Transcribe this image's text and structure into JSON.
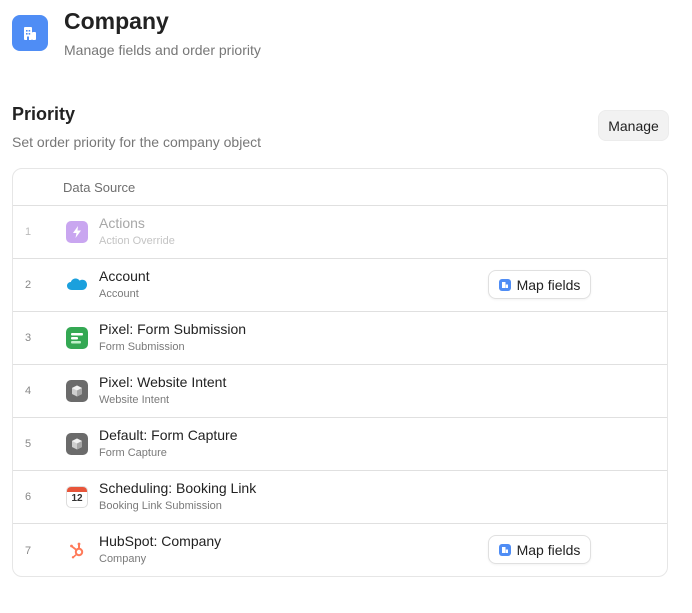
{
  "header": {
    "title": "Company",
    "subtitle": "Manage fields and order priority",
    "icon": "building-icon",
    "icon_color": "#4f8df5"
  },
  "priority": {
    "title": "Priority",
    "subtitle": "Set order priority for the company object",
    "manage_label": "Manage"
  },
  "table": {
    "column_header": "Data Source",
    "map_fields_label": "Map fields",
    "rows": [
      {
        "num": "1",
        "name": "Actions",
        "sub": "Action Override",
        "icon": "lightning-icon",
        "disabled": true
      },
      {
        "num": "2",
        "name": "Account",
        "sub": "Account",
        "icon": "salesforce-cloud-icon",
        "map_fields": true
      },
      {
        "num": "3",
        "name": "Pixel: Form Submission",
        "sub": "Form Submission",
        "icon": "form-icon"
      },
      {
        "num": "4",
        "name": "Pixel: Website Intent",
        "sub": "Website Intent",
        "icon": "cube-icon"
      },
      {
        "num": "5",
        "name": "Default: Form Capture",
        "sub": "Form Capture",
        "icon": "cube-icon"
      },
      {
        "num": "6",
        "name": "Scheduling: Booking Link",
        "sub": "Booking Link Submission",
        "icon": "calendar-icon",
        "icon_text": "12"
      },
      {
        "num": "7",
        "name": "HubSpot: Company",
        "sub": "Company",
        "icon": "hubspot-icon",
        "map_fields": true
      }
    ]
  }
}
